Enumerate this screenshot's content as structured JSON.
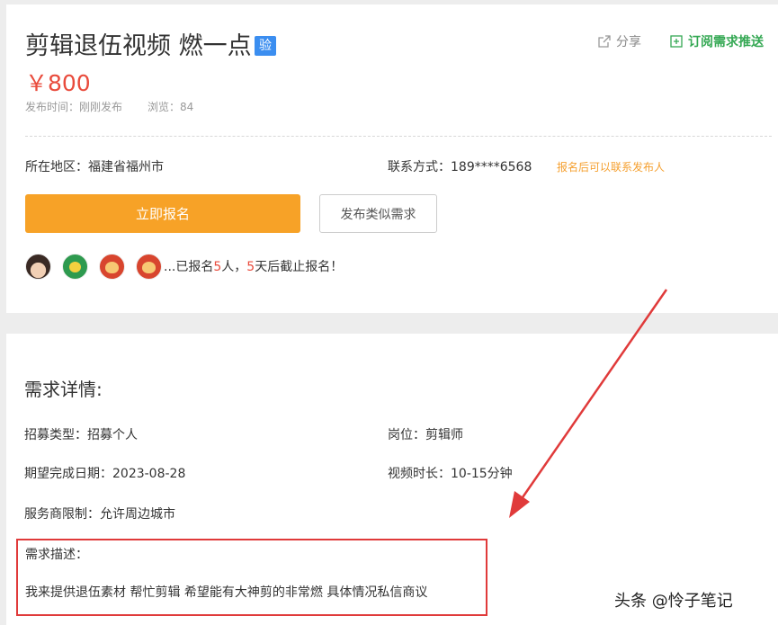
{
  "job": {
    "title": "剪辑退伍视频 燃一点",
    "badge": "验",
    "price": "￥800",
    "publish_time": "发布时间：刚刚发布",
    "views": "浏览：84",
    "share_label": "分享",
    "subscribe_label": "订阅需求推送",
    "region": "所在地区：福建省福州市",
    "contact": "联系方式：189****6568",
    "contact_tip": "报名后可以联系发布人",
    "apply_button": "立即报名",
    "similar_button": "发布类似需求",
    "signup": {
      "prefix": "...已报名",
      "count": "5",
      "mid": "人，",
      "days": "5",
      "suffix": "天后截止报名！"
    }
  },
  "detail": {
    "heading": "需求详情:",
    "recruit_type": "招募类型：招募个人",
    "position": "岗位：剪辑师",
    "deadline": "期望完成日期：2023-08-28",
    "duration": "视频时长：10-15分钟",
    "provider_limit": "服务商限制：允许周边城市",
    "description_title": "需求描述：",
    "description": "我来提供退伍素材  帮忙剪辑  希望能有大神剪的非常燃 具体情况私信商议"
  },
  "watermark": "头条 @怜子笔记",
  "colors": {
    "accent_orange": "#f7a227",
    "price_red": "#e94b3c",
    "badge_blue": "#3b8ef0",
    "subscribe_green": "#34a853",
    "annotation_red": "#e03a3a"
  },
  "icons": {
    "share": "share-icon",
    "subscribe": "plus-square-icon"
  }
}
